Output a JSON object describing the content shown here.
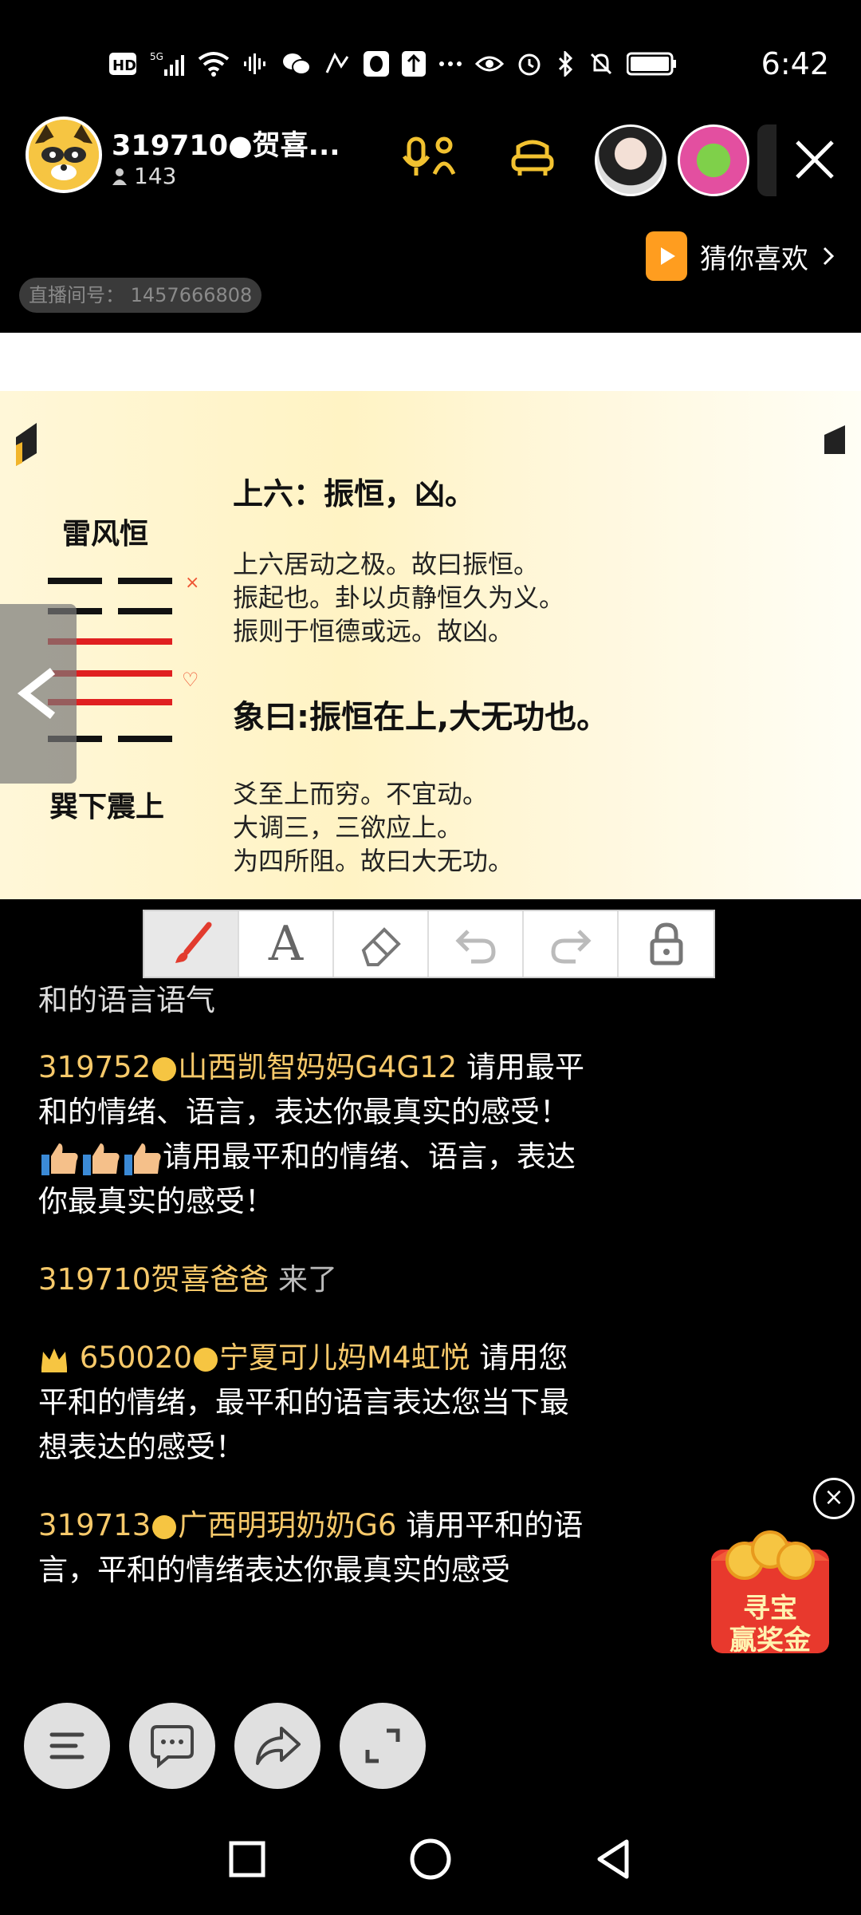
{
  "status": {
    "time": "6:42",
    "icons": [
      "hd-icon",
      "signal-icon",
      "wifi-icon",
      "audio-icon",
      "wechat-icon",
      "app-icon",
      "qq-icon",
      "upload-icon",
      "more-icon",
      "eye-icon",
      "alarm-icon",
      "bluetooth-icon",
      "mute-icon",
      "battery-icon"
    ]
  },
  "header": {
    "host_name": "319710●贺喜...",
    "viewer_count": "143",
    "recommend_label": "猜你喜欢",
    "room_id": "直播间号： 1457666808"
  },
  "slide": {
    "hex_title": "雷风恒",
    "hex_sub": "巽下震上",
    "line_head": "上六：振恒，凶。",
    "para1": [
      "上六居动之极。故曰振恒。",
      "振起也。卦以贞静恒久为义。",
      "振则于恒德或远。故凶。"
    ],
    "xiang": "象曰:振恒在上,大无功也。",
    "para2": [
      "爻至上而穷。不宜动。",
      "大调三，三欲应上。",
      "为四所阻。故曰大无功。"
    ],
    "mark_x": "×",
    "mark_o": "♡"
  },
  "toolbar": {
    "tools": [
      "brush-tool",
      "text-tool",
      "eraser-tool",
      "undo-tool",
      "redo-tool",
      "lock-tool"
    ],
    "text_glyph": "A",
    "active": "brush-tool"
  },
  "chat": {
    "partial": "和的语言语气",
    "messages": [
      {
        "user_id": "319752",
        "user_name": "山西凯智妈妈G4G12",
        "text1": " 请用最平和的情绪、语言，表达你最真实的感受！",
        "text2": "请用最平和的情绪、语言，表达你最真实的感受！"
      },
      {
        "user_id": "319710贺喜爸爸",
        "joined": "来了"
      },
      {
        "user_id": "650020",
        "user_name": "宁夏可儿妈M4虹悦",
        "text1": " 请用您平和的情绪，最平和的语言表达您当下最想表达的感受！"
      },
      {
        "user_id": "319713",
        "user_name": "广西明玥奶奶G6",
        "text1": " 请用平和的语言，平和的情绪表达你最真实的感受"
      }
    ]
  },
  "reward": {
    "line1": "寻宝",
    "line2": "赢奖金"
  }
}
